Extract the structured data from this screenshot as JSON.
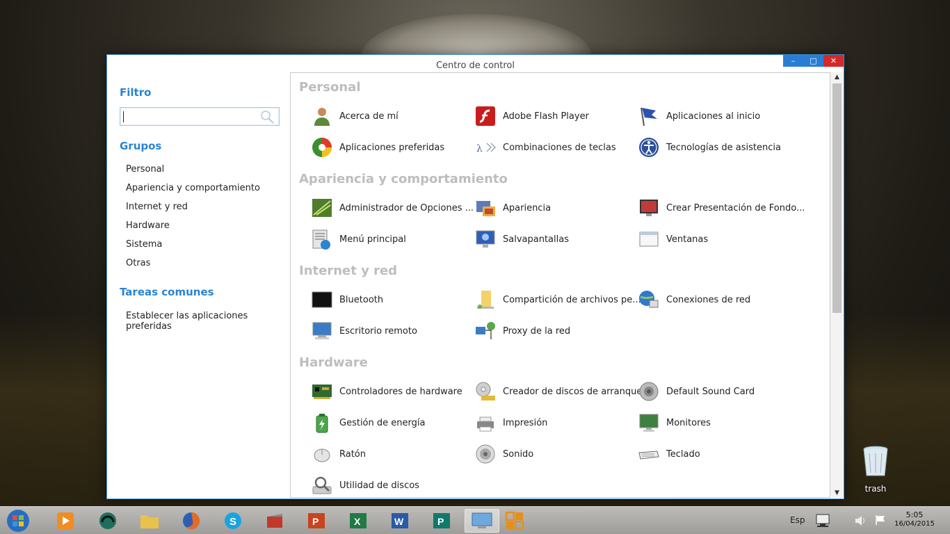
{
  "window": {
    "title": "Centro de control",
    "controls": {
      "minimize": "–",
      "maximize": "□",
      "close": "✕"
    }
  },
  "sidebar": {
    "filter_heading": "Filtro",
    "search": {
      "value": "",
      "placeholder": ""
    },
    "groups_heading": "Grupos",
    "groups": [
      "Personal",
      "Apariencia y comportamiento",
      "Internet y red",
      "Hardware",
      "Sistema",
      "Otras"
    ],
    "tasks_heading": "Tareas comunes",
    "tasks": [
      "Establecer las aplicaciones preferidas"
    ]
  },
  "sections": [
    {
      "title": "Personal",
      "items": [
        {
          "label": "Acerca de mí",
          "icon": "user-icon"
        },
        {
          "label": "Adobe Flash Player",
          "icon": "flash-icon"
        },
        {
          "label": "Aplicaciones al inicio",
          "icon": "flag-icon"
        },
        {
          "label": "Aplicaciones preferidas",
          "icon": "preferred-apps-icon"
        },
        {
          "label": "Combinaciones de teclas",
          "icon": "keyboard-shortcuts-icon"
        },
        {
          "label": "Tecnologías de asistencia",
          "icon": "accessibility-icon"
        }
      ]
    },
    {
      "title": "Apariencia y comportamiento",
      "items": [
        {
          "label": "Administrador de Opciones ...",
          "icon": "options-manager-icon"
        },
        {
          "label": "Apariencia",
          "icon": "appearance-icon"
        },
        {
          "label": "Crear Presentación de Fondo...",
          "icon": "slideshow-icon"
        },
        {
          "label": "Menú principal",
          "icon": "main-menu-icon"
        },
        {
          "label": "Salvapantallas",
          "icon": "screensaver-icon"
        },
        {
          "label": "Ventanas",
          "icon": "windows-icon"
        }
      ]
    },
    {
      "title": "Internet y red",
      "items": [
        {
          "label": "Bluetooth",
          "icon": "bluetooth-icon"
        },
        {
          "label": "Compartición de archivos pe...",
          "icon": "file-sharing-icon"
        },
        {
          "label": "Conexiones de red",
          "icon": "network-connections-icon"
        },
        {
          "label": "Escritorio remoto",
          "icon": "remote-desktop-icon"
        },
        {
          "label": "Proxy de la red",
          "icon": "network-proxy-icon"
        }
      ]
    },
    {
      "title": "Hardware",
      "items": [
        {
          "label": "Controladores de hardware",
          "icon": "hardware-drivers-icon"
        },
        {
          "label": "Creador de discos de arranque",
          "icon": "boot-disk-icon"
        },
        {
          "label": "Default Sound Card",
          "icon": "sound-card-icon"
        },
        {
          "label": "Gestión de energía",
          "icon": "power-management-icon"
        },
        {
          "label": "Impresión",
          "icon": "printer-icon"
        },
        {
          "label": "Monitores",
          "icon": "monitors-icon"
        },
        {
          "label": "Ratón",
          "icon": "mouse-icon"
        },
        {
          "label": "Sonido",
          "icon": "sound-icon"
        },
        {
          "label": "Teclado",
          "icon": "keyboard-icon"
        },
        {
          "label": "Utilidad de discos",
          "icon": "disk-utility-icon"
        }
      ]
    }
  ],
  "desktop": {
    "trash_label": "trash"
  },
  "taskbar": {
    "apps": [
      "media-player-icon",
      "headphones-icon",
      "file-manager-icon",
      "firefox-icon",
      "skype-icon",
      "video-editor-icon",
      "powerpoint-icon",
      "excel-icon",
      "word-icon",
      "publisher-icon",
      "control-center-icon",
      "tiles-icon"
    ],
    "language": "Esp",
    "time": "5:05",
    "date": "16/04/2015"
  },
  "colors": {
    "accent": "#2a84d2",
    "section_title": "#bdbdbd",
    "close": "#d22a2a"
  }
}
